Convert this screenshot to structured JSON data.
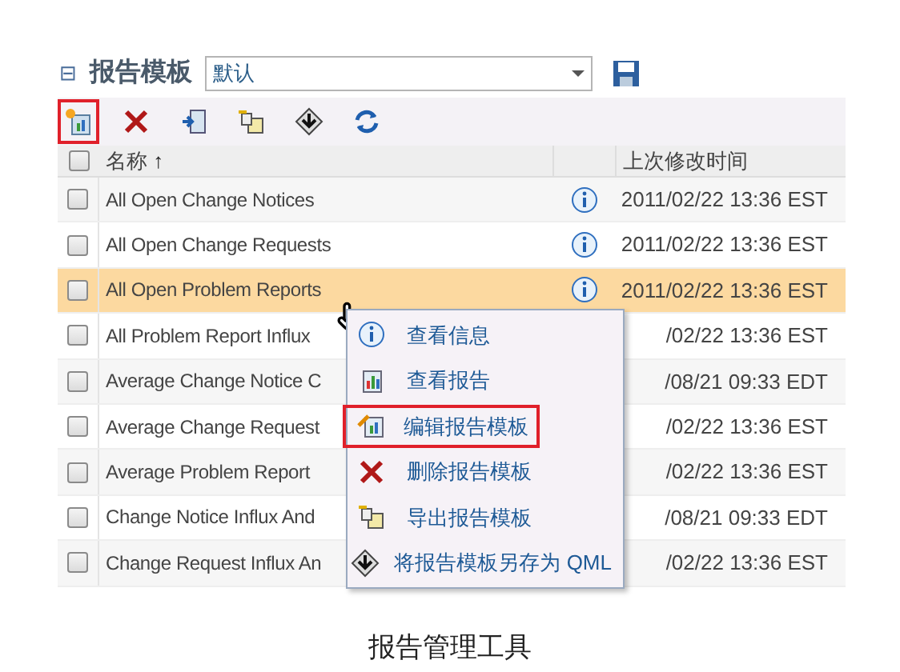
{
  "header": {
    "collapse_glyph": "⊟",
    "title": "报告模板",
    "template_select": {
      "value": "默认"
    }
  },
  "toolbar": [
    {
      "kind": "new",
      "highlighted": true
    },
    {
      "kind": "delete",
      "highlighted": false
    },
    {
      "kind": "open",
      "highlighted": false
    },
    {
      "kind": "export",
      "highlighted": false
    },
    {
      "kind": "import",
      "highlighted": false
    },
    {
      "kind": "refresh",
      "highlighted": false
    }
  ],
  "table": {
    "select_all_checked": false,
    "columns": [
      {
        "label": "名称",
        "sort_glyph": "↑"
      },
      {},
      {
        "label": "上次修改时间"
      }
    ],
    "rows": [
      {
        "name": "All Open Change Notices",
        "checked": false,
        "info": true,
        "modified": "2011/02/22 13:36 EST",
        "selected": false
      },
      {
        "name": "All Open Change Requests",
        "checked": false,
        "info": true,
        "modified": "2011/02/22 13:36 EST",
        "selected": false
      },
      {
        "name": "All Open Problem Reports",
        "checked": false,
        "info": true,
        "modified": "2011/02/22 13:36 EST",
        "selected": true
      },
      {
        "name": "All Problem Report Influx",
        "checked": false,
        "modified": "/02/22 13:36 EST",
        "selected": false
      },
      {
        "name": "Average Change Notice C",
        "checked": false,
        "modified": "/08/21 09:33 EDT",
        "selected": false
      },
      {
        "name": "Average Change Request",
        "checked": false,
        "modified": "/02/22 13:36 EST",
        "selected": false
      },
      {
        "name": "Average Problem Report",
        "checked": false,
        "modified": "/02/22 13:36 EST",
        "selected": false
      },
      {
        "name": "Change Notice Influx And",
        "checked": false,
        "modified": "/08/21 09:33 EDT",
        "selected": false
      },
      {
        "name": "Change Request Influx An",
        "checked": false,
        "modified": "/02/22 13:36 EST",
        "selected": false
      }
    ]
  },
  "context_menu": [
    {
      "kind": "info",
      "label": "查看信息",
      "highlighted": false
    },
    {
      "kind": "report",
      "label": "查看报告",
      "highlighted": false
    },
    {
      "kind": "edit",
      "label": "编辑报告模板",
      "highlighted": true
    },
    {
      "kind": "delete",
      "label": "删除报告模板",
      "highlighted": false
    },
    {
      "kind": "export",
      "label": "导出报告模板",
      "highlighted": false
    },
    {
      "kind": "saveas",
      "label": "将报告模板另存为 QML",
      "highlighted": false
    }
  ],
  "caption": "报告管理工具"
}
